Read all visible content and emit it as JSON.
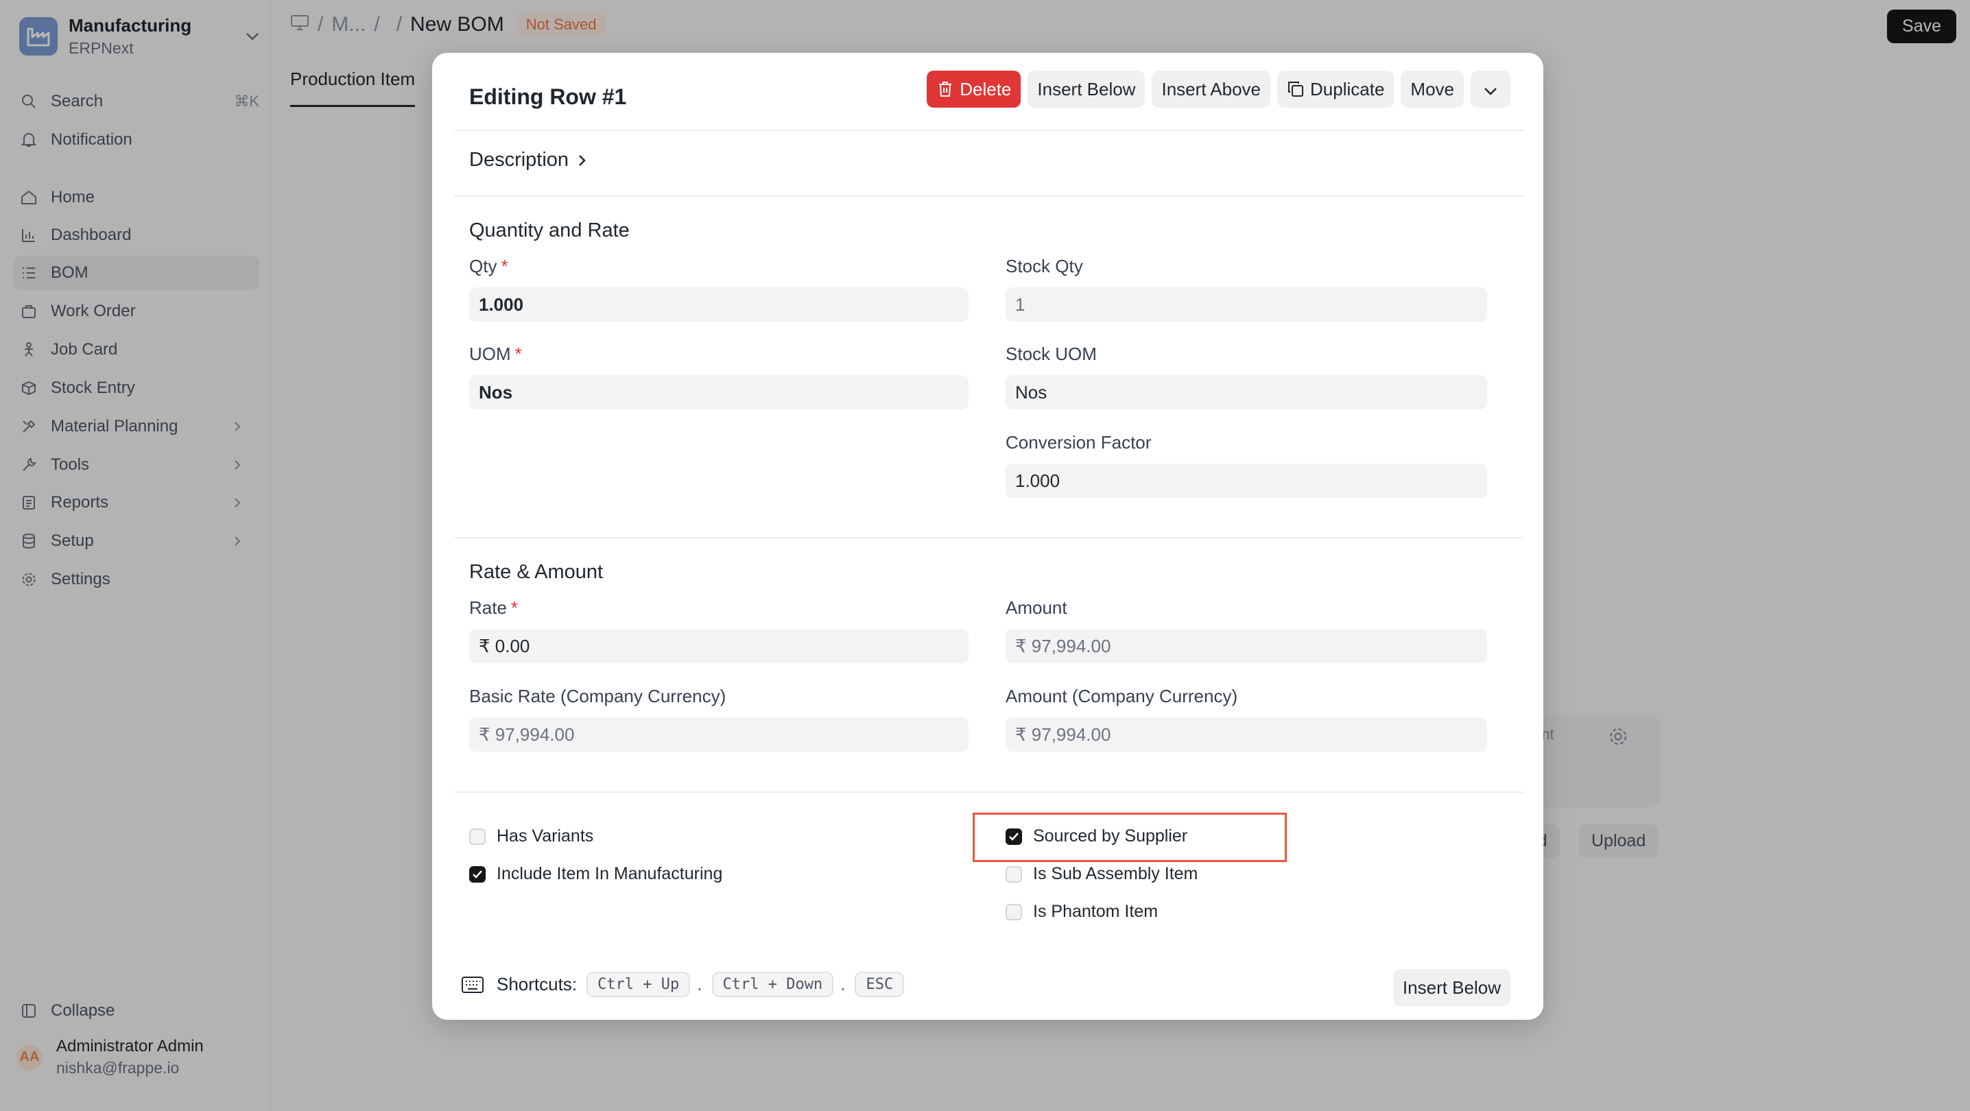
{
  "app": {
    "name": "Manufacturing",
    "sub": "ERPNext"
  },
  "search": {
    "label": "Search",
    "shortcut": "⌘K"
  },
  "notification": {
    "label": "Notification"
  },
  "sidebar": {
    "items": [
      {
        "label": "Home",
        "icon": "home-icon"
      },
      {
        "label": "Dashboard",
        "icon": "chart-icon"
      },
      {
        "label": "BOM",
        "icon": "list-icon"
      },
      {
        "label": "Work Order",
        "icon": "briefcase-icon"
      },
      {
        "label": "Job Card",
        "icon": "person-icon"
      },
      {
        "label": "Stock Entry",
        "icon": "box-icon"
      },
      {
        "label": "Material Planning",
        "icon": "tools-icon"
      },
      {
        "label": "Tools",
        "icon": "wrench-icon"
      },
      {
        "label": "Reports",
        "icon": "report-icon"
      },
      {
        "label": "Setup",
        "icon": "database-icon"
      },
      {
        "label": "Settings",
        "icon": "gear-icon"
      }
    ],
    "collapse": "Collapse"
  },
  "user": {
    "initials": "AA",
    "name": "Administrator Admin",
    "email": "nishka@frappe.io"
  },
  "breadcrumb": {
    "part1": "M...",
    "current": "New BOM",
    "status": "Not Saved"
  },
  "toolbar": {
    "save": "Save"
  },
  "background": {
    "tab": "Production Item",
    "card_text": "unt",
    "upload1": "oad",
    "upload2": "Upload"
  },
  "dialog": {
    "title": "Editing Row #1",
    "actions": {
      "delete": "Delete",
      "insert_below": "Insert Below",
      "insert_above": "Insert Above",
      "duplicate": "Duplicate",
      "move": "Move"
    },
    "description": "Description",
    "qty_section": "Quantity and Rate",
    "qty": {
      "label": "Qty",
      "value": "1.000"
    },
    "stock_qty": {
      "label": "Stock Qty",
      "value": "1"
    },
    "uom": {
      "label": "UOM",
      "value": "Nos"
    },
    "stock_uom": {
      "label": "Stock UOM",
      "value": "Nos"
    },
    "conversion": {
      "label": "Conversion Factor",
      "value": "1.000"
    },
    "rate_section": "Rate & Amount",
    "rate": {
      "label": "Rate",
      "value": "₹ 0.00"
    },
    "amount": {
      "label": "Amount",
      "value": "₹ 97,994.00"
    },
    "basic_rate": {
      "label": "Basic Rate (Company Currency)",
      "value": "₹ 97,994.00"
    },
    "amount_company": {
      "label": "Amount (Company Currency)",
      "value": "₹ 97,994.00"
    },
    "checks": {
      "has_variants": {
        "label": "Has Variants",
        "checked": false
      },
      "include_mfg": {
        "label": "Include Item In Manufacturing",
        "checked": true
      },
      "sourced_supplier": {
        "label": "Sourced by Supplier",
        "checked": true
      },
      "sub_assembly": {
        "label": "Is Sub Assembly Item",
        "checked": false
      },
      "phantom": {
        "label": "Is Phantom Item",
        "checked": false
      }
    },
    "shortcuts": {
      "label": "Shortcuts:",
      "k1": "Ctrl + Up",
      "k2": "Ctrl + Down",
      "k3": "ESC",
      "sep": "."
    },
    "insert_below_bottom": "Insert Below"
  }
}
